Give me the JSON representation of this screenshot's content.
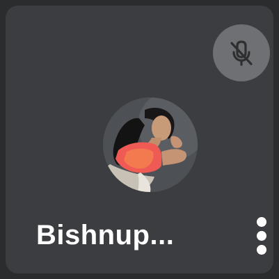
{
  "participant": {
    "name": "Bishnup...",
    "mic_status_icon": "mic-off-icon",
    "avatar_icon": "avatar-photo",
    "more_options_icon": "more-vert-icon"
  },
  "colors": {
    "tile_background": "#3b3d40",
    "page_background": "#2b2c2e",
    "mic_badge": "#6e7073",
    "text": "#ffffff"
  }
}
